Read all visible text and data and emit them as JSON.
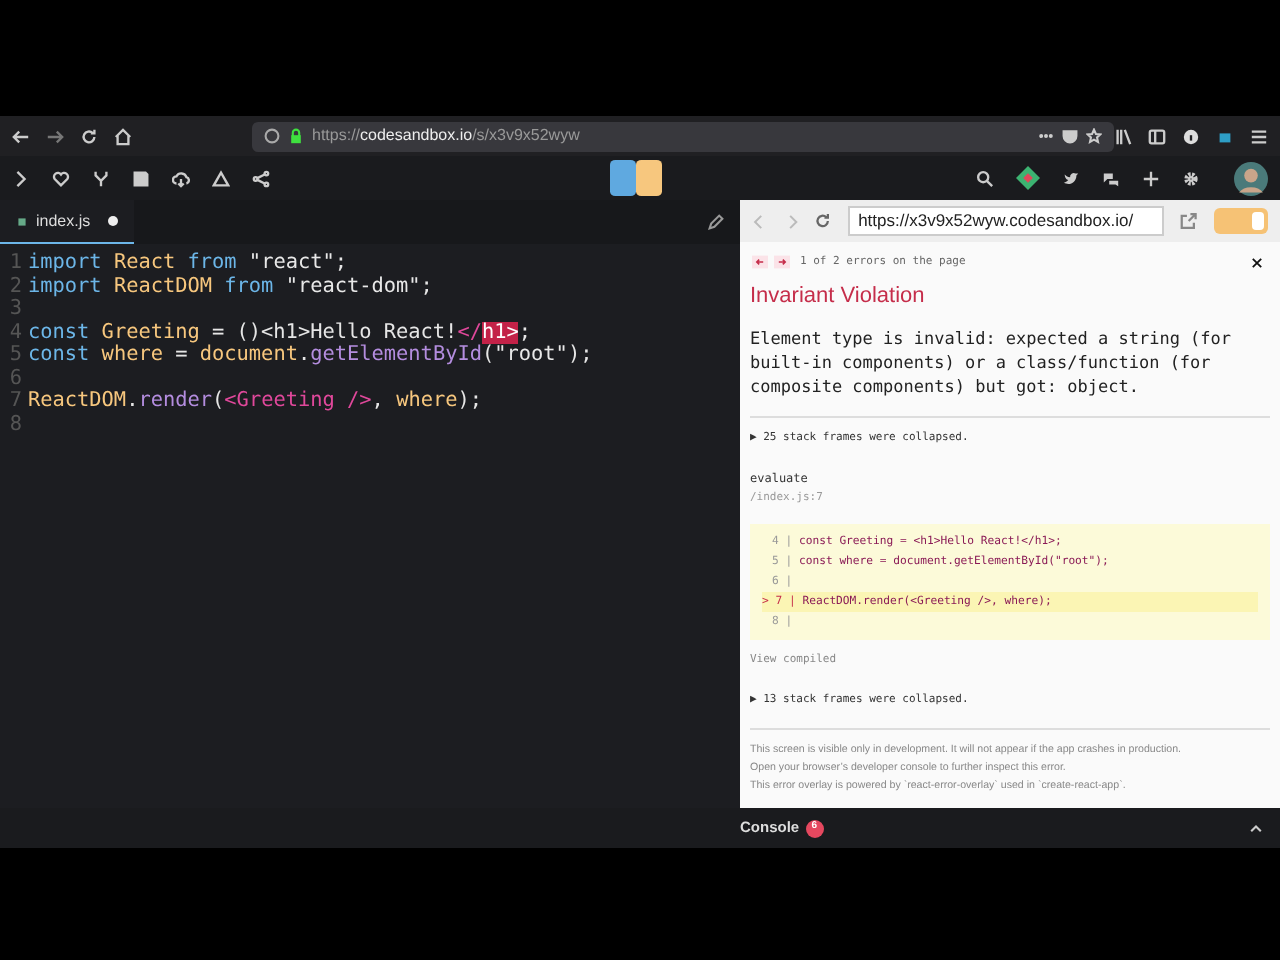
{
  "browser": {
    "url": "https://**codesandbox.io**/s/x3v9x52wyw"
  },
  "editor": {
    "tab": {
      "label": "index.js",
      "modified": true
    },
    "lines": [
      {
        "number": "1",
        "tokens": [
          {
            "kind": "keyword",
            "text": "import"
          },
          {
            "kind": "name",
            "text": " React"
          },
          {
            "kind": "keyword",
            "text": " from"
          },
          {
            "kind": "string",
            "text": " \"react\""
          },
          {
            "kind": "plain",
            "text": ";"
          }
        ]
      },
      {
        "number": "2",
        "tokens": [
          {
            "kind": "keyword",
            "text": "import"
          },
          {
            "kind": "name",
            "text": " ReactDOM"
          },
          {
            "kind": "keyword",
            "text": " from"
          },
          {
            "kind": "string",
            "text": " \"react-dom\""
          },
          {
            "kind": "plain",
            "text": ";"
          }
        ]
      },
      {
        "number": "3"
      },
      {
        "number": "4",
        "tokens": [
          {
            "kind": "keyword",
            "text": "const"
          },
          {
            "kind": "name",
            "text": " Greeting"
          },
          {
            "kind": "plain",
            "text": " = ()<h1>Hello React!"
          },
          {
            "kind": "tag",
            "text": "</"
          },
          {
            "kind": "error",
            "text": "h1>"
          },
          {
            "kind": "plain",
            "text": ";"
          }
        ]
      },
      {
        "number": "5",
        "tokens": [
          {
            "kind": "keyword",
            "text": "const"
          },
          {
            "kind": "name",
            "text": " where"
          },
          {
            "kind": "plain",
            "text": " = "
          },
          {
            "kind": "name",
            "text": "document"
          },
          {
            "kind": "plain",
            "text": "."
          },
          {
            "kind": "func",
            "text": "getElementById"
          },
          {
            "kind": "plain",
            "text": "("
          },
          {
            "kind": "string",
            "text": "\"root\""
          },
          {
            "kind": "plain",
            "text": ");"
          }
        ]
      },
      {
        "number": "6"
      },
      {
        "number": "7",
        "tokens": [
          {
            "kind": "name",
            "text": "ReactDOM"
          },
          {
            "kind": "plain",
            "text": "."
          },
          {
            "kind": "func",
            "text": "render"
          },
          {
            "kind": "plain",
            "text": "("
          },
          {
            "kind": "tag",
            "text": "<Greeting />"
          },
          {
            "kind": "plain",
            "text": ", "
          },
          {
            "kind": "name",
            "text": "where"
          },
          {
            "kind": "plain",
            "text": ");"
          }
        ]
      },
      {
        "number": "8"
      }
    ]
  },
  "preview": {
    "address": "https://x3v9x52wyw.codesandbox.io/",
    "toggle": {
      "on": true
    },
    "error_nav": "1 of 2 errors on the page",
    "title": "Invariant Violation",
    "message": "Element type is invalid: expected a string (for built-in components) or a class/function (for composite components) but got: object.",
    "collapsed_top": "▶ 25 stack frames were collapsed.",
    "frame": {
      "function": "evaluate",
      "location": "/index.js:7",
      "lines": [
        {
          "gutter": "4 |",
          "code": "const Greeting = <h1>Hello React!</h1>;",
          "highlighted": false
        },
        {
          "gutter": "5 |",
          "code": "const where = document.getElementById(\"root\");",
          "highlighted": false
        },
        {
          "gutter": "6 |",
          "highlighted": false
        },
        {
          "gutter": "> 7 |",
          "code": "ReactDOM.render(<Greeting />, where);",
          "highlighted": true
        },
        {
          "gutter": "8 |",
          "highlighted": false
        }
      ],
      "link": "View compiled"
    },
    "collapsed_bottom": "▶ 13 stack frames were collapsed.",
    "footer": [
      "This screen is visible only in development. It will not appear if the app crashes in production.",
      "Open your browser’s developer console to further inspect this error.",
      "This error overlay is powered by `react-error-overlay` used in `create-react-app`."
    ]
  },
  "console": {
    "label": "Console",
    "badge": "6"
  }
}
